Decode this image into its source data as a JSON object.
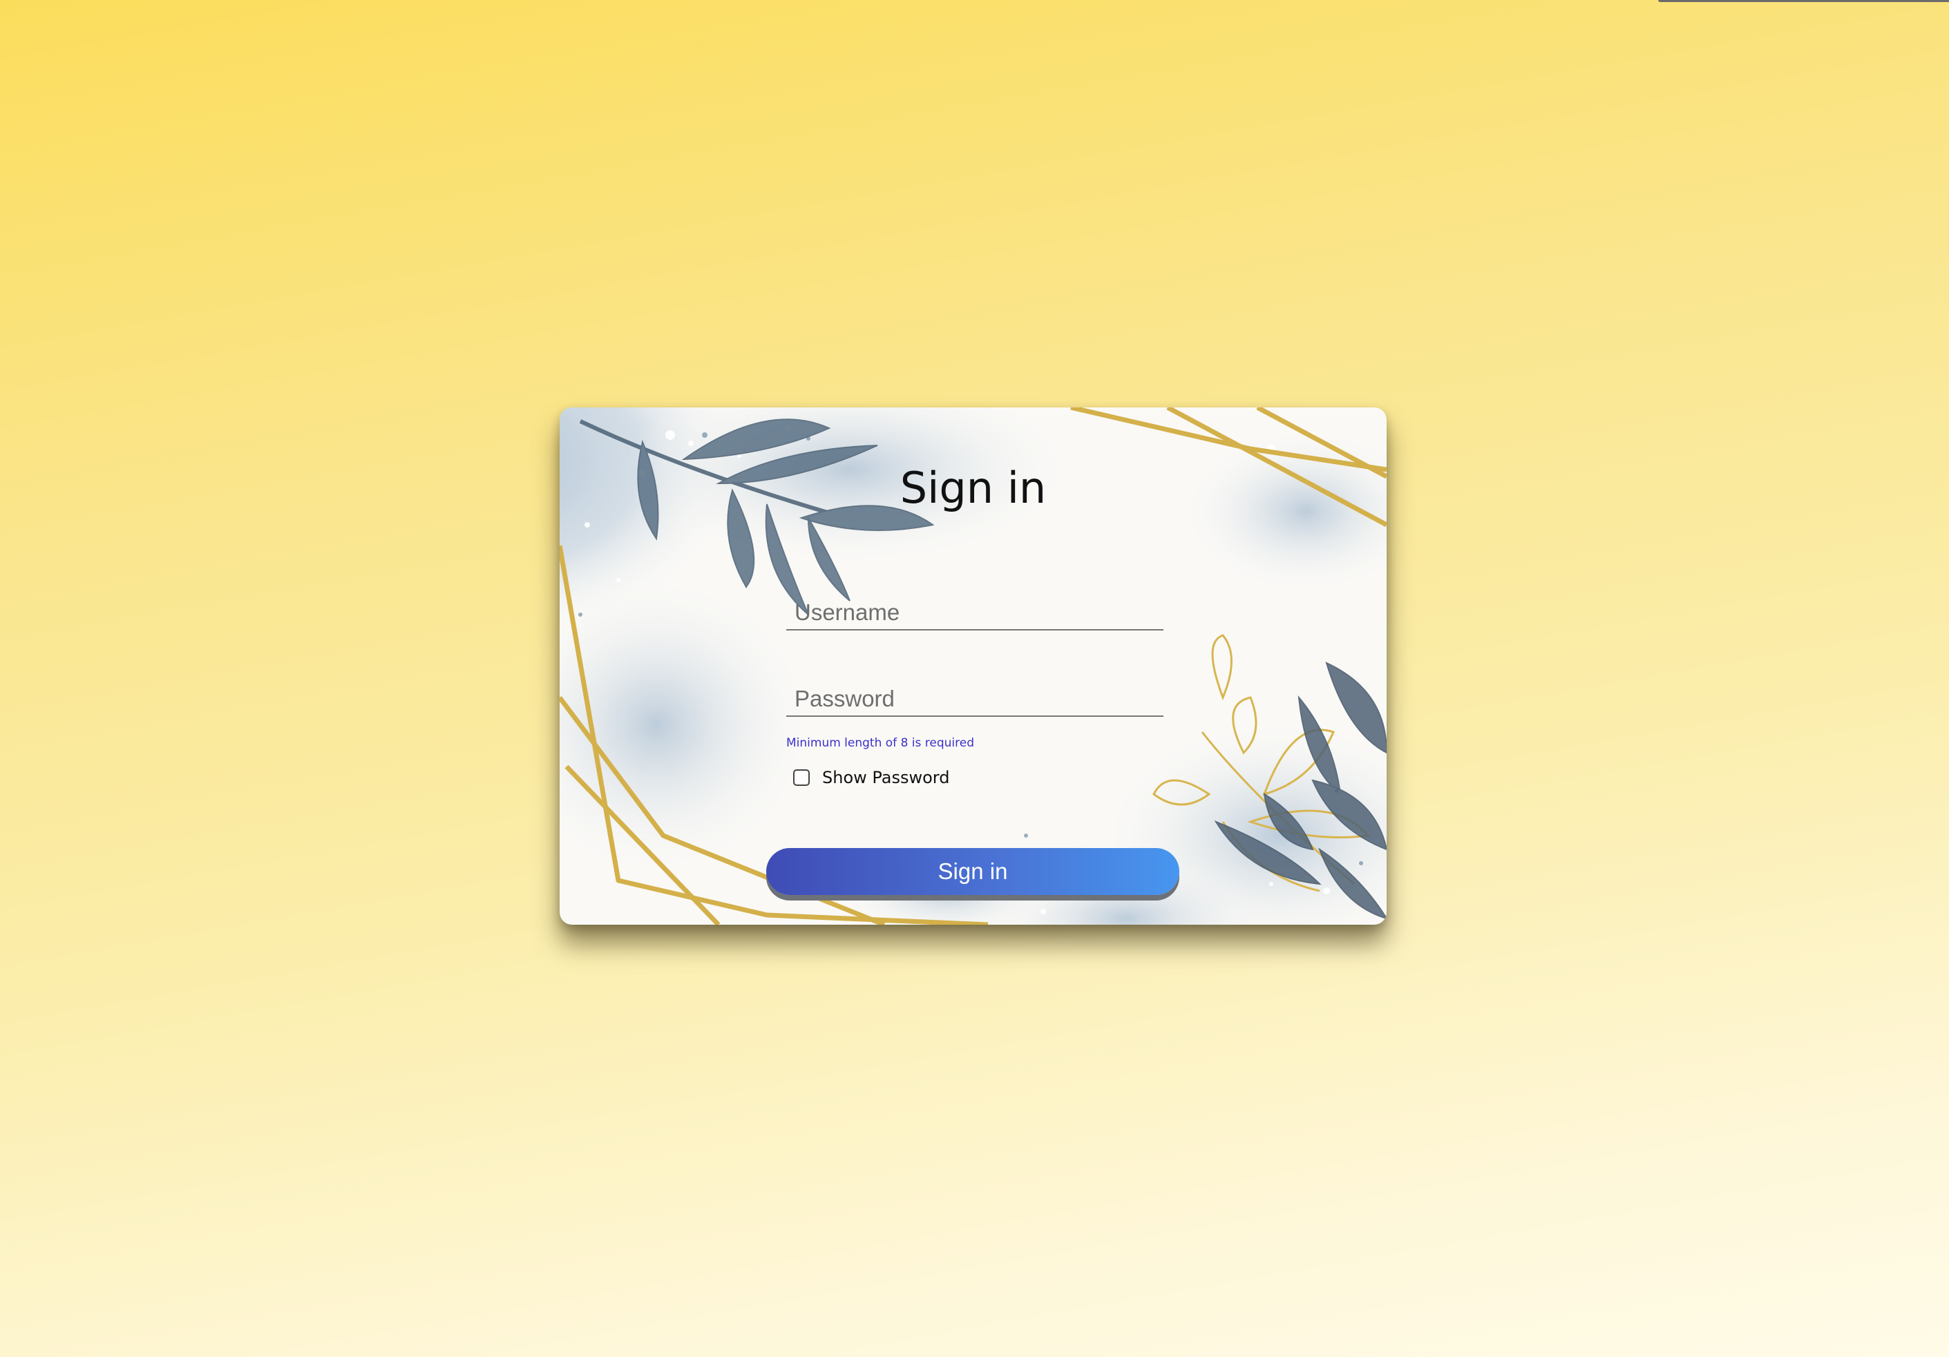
{
  "page": {
    "background_colors": [
      "#fbdd5c",
      "#fef7d8"
    ]
  },
  "card": {
    "title": "Sign in",
    "username": {
      "placeholder": "Username",
      "value": ""
    },
    "password": {
      "placeholder": "Password",
      "value": "",
      "hint": "Minimum length of 8 is required"
    },
    "show_password": {
      "label": "Show Password",
      "checked": false
    },
    "submit_label": "Sign in",
    "decoration": [
      "watercolor-leaf-icon",
      "gold-frame-lines"
    ]
  },
  "colors": {
    "hint": "#3a31c9",
    "button_start": "#3f4cb5",
    "button_end": "#4796ef",
    "gold": "#d4b04a",
    "leaf": "#5d7488"
  }
}
